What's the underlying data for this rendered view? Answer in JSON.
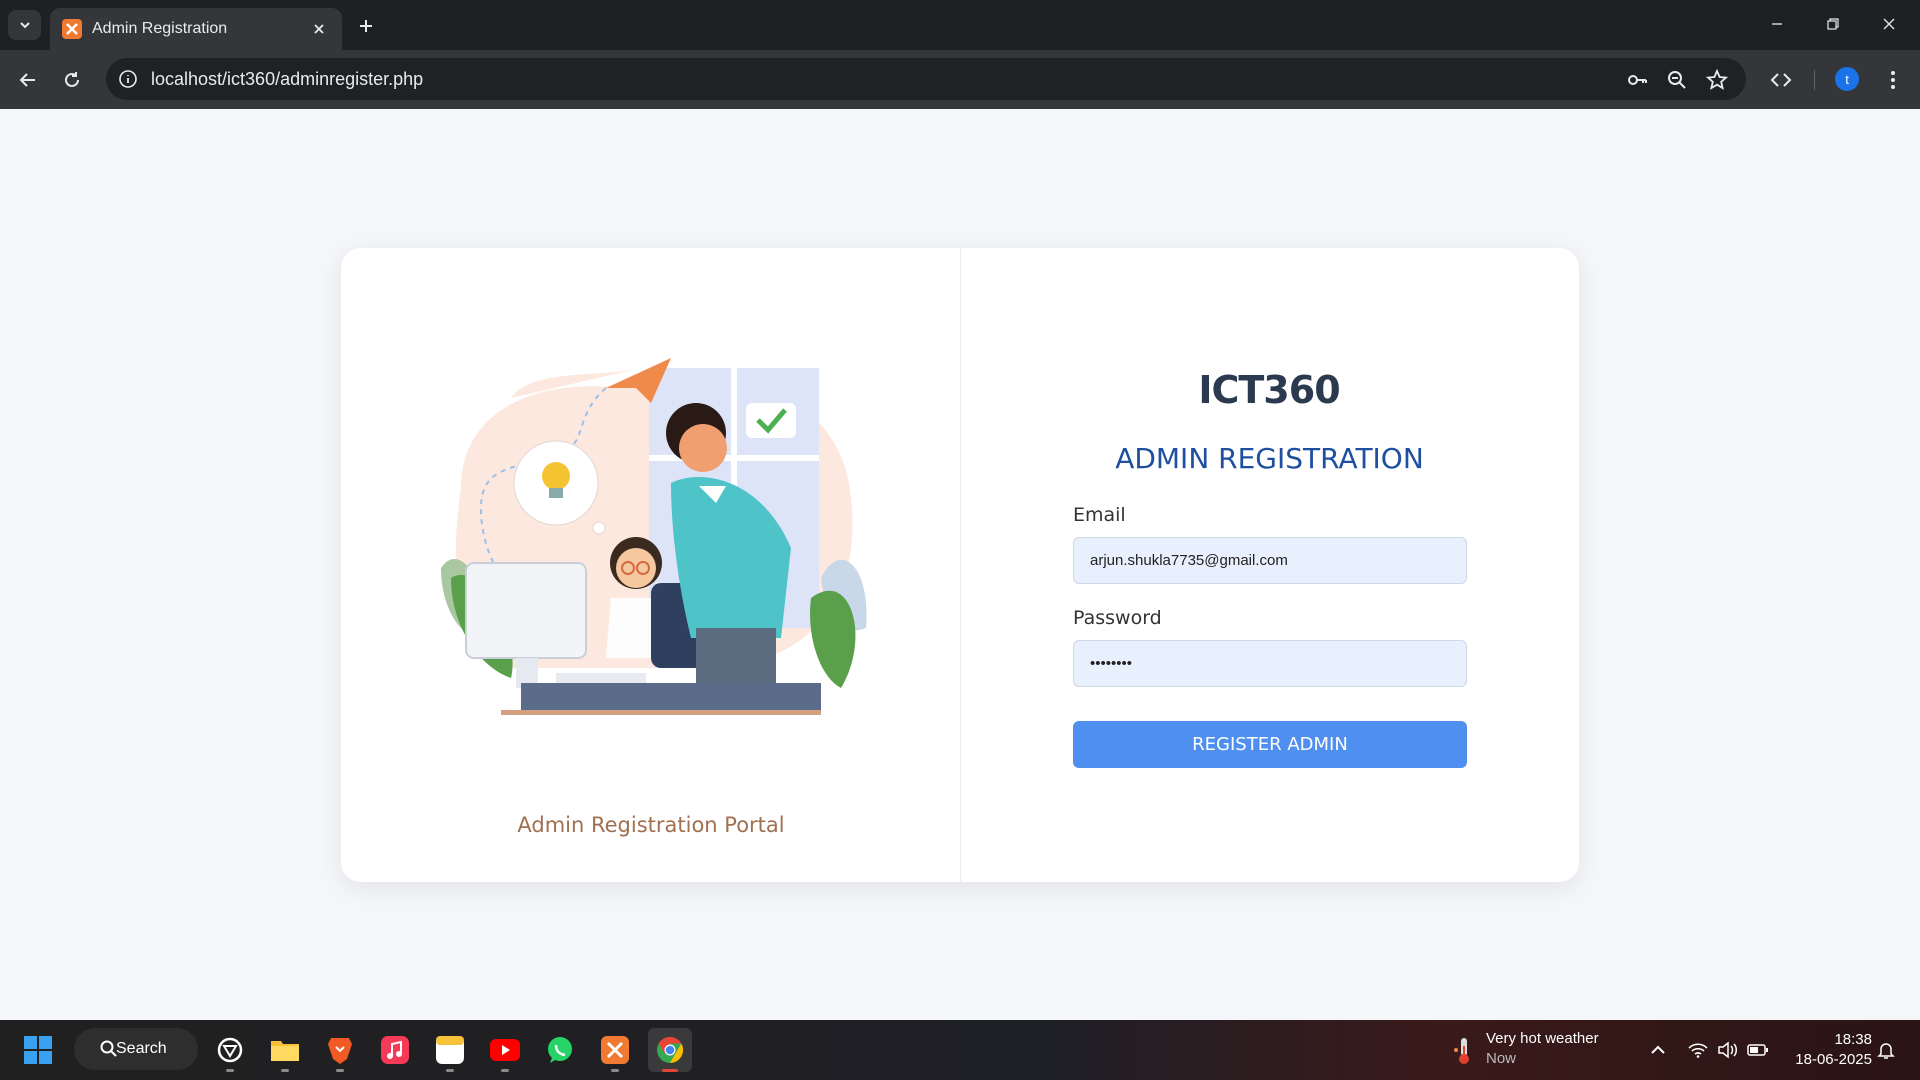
{
  "browser": {
    "tab_title": "Admin Registration",
    "url": "localhost/ict360/adminregister.php",
    "profile_initial": "t"
  },
  "page": {
    "caption": "Admin Registration Portal",
    "logo_text": "ICT360",
    "title": "ADMIN REGISTRATION",
    "email_label": "Email",
    "email_value": "arjun.shukla7735@gmail.com",
    "password_label": "Password",
    "password_value": "••••••••",
    "submit_label": "REGISTER ADMIN"
  },
  "taskbar": {
    "search_label": "Search",
    "weather_title": "Very hot weather",
    "weather_sub": "Now",
    "time": "18:38",
    "date": "18-06-2025"
  },
  "colors": {
    "accent": "#4f8ff0",
    "title": "#1e4fa0",
    "caption": "#a07050"
  }
}
